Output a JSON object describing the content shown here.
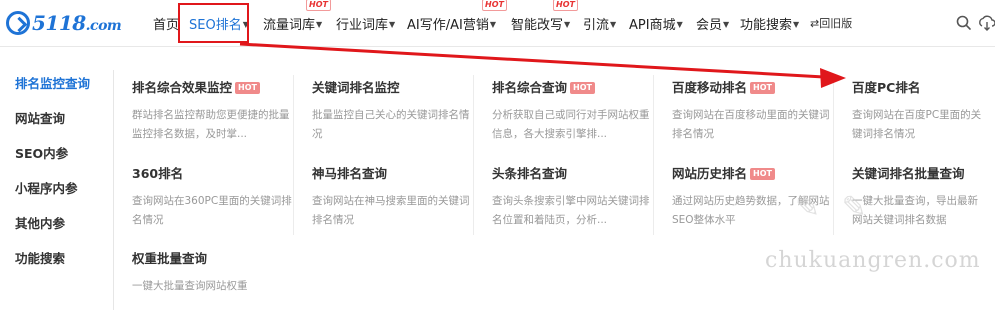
{
  "logo": {
    "text": "5118",
    "suffix": ".com"
  },
  "nav": {
    "items": [
      {
        "label": "首页",
        "caret": false
      },
      {
        "label": "SEO排名",
        "caret": true
      },
      {
        "label": "流量词库",
        "caret": true
      },
      {
        "label": "行业词库",
        "caret": true
      },
      {
        "label": "AI写作/AI营销",
        "caret": true
      },
      {
        "label": "智能改写",
        "caret": true
      },
      {
        "label": "引流",
        "caret": true
      },
      {
        "label": "API商城",
        "caret": true
      },
      {
        "label": "会员",
        "caret": true
      },
      {
        "label": "功能搜索",
        "caret": true
      }
    ],
    "hot_label": "HOT",
    "return_old": "回旧版",
    "icons": [
      "search-icon",
      "cloud-download-icon"
    ]
  },
  "sidebar": {
    "items": [
      "排名监控查询",
      "网站查询",
      "SEO内参",
      "小程序内参",
      "其他内参",
      "功能搜索"
    ]
  },
  "cards": [
    {
      "title": "排名综合效果监控",
      "hot": true,
      "desc": "群站排名监控帮助您更便捷的批量监控排名数据，及时掌..."
    },
    {
      "title": "关键词排名监控",
      "hot": false,
      "desc": "批量监控自己关心的关键词排名情况"
    },
    {
      "title": "排名综合查询",
      "hot": true,
      "desc": "分析获取自己或同行对手网站权重信息，各大搜索引擎排..."
    },
    {
      "title": "百度移动排名",
      "hot": true,
      "desc": "查询网站在百度移动里面的关键词排名情况"
    },
    {
      "title": "百度PC排名",
      "hot": false,
      "desc": "查询网站在百度PC里面的关键词排名情况"
    },
    {
      "title": "360排名",
      "hot": false,
      "desc": "查询网站在360PC里面的关键词排名情况"
    },
    {
      "title": "神马排名查询",
      "hot": false,
      "desc": "查询网站在神马搜索里面的关键词排名情况"
    },
    {
      "title": "头条排名查询",
      "hot": false,
      "desc": "查询头条搜索引擎中网站关键词排名位置和着陆页，分析..."
    },
    {
      "title": "网站历史排名",
      "hot": true,
      "desc": "通过网站历史趋势数据，了解网站SEO整体水平"
    },
    {
      "title": "关键词排名批量查询",
      "hot": false,
      "desc": "一键大批量查询，导出最新网站关键词排名数据"
    },
    {
      "title": "权重批量查询",
      "hot": false,
      "desc": "一键大批量查询网站权重"
    }
  ],
  "watermark": "chukuangren.com",
  "colors": {
    "accent": "#1e73d6",
    "highlight_box": "#e0171b",
    "hot": "#e83333"
  }
}
